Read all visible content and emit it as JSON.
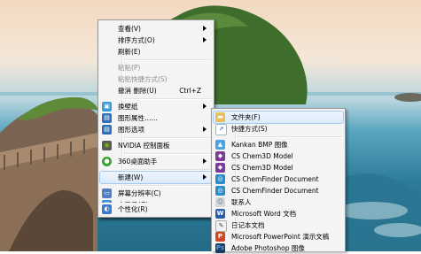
{
  "context_menu": {
    "items": [
      {
        "label": "查看(V)",
        "submenu": true,
        "disabled": false
      },
      {
        "label": "排序方式(O)",
        "submenu": true,
        "disabled": false
      },
      {
        "label": "刷新(E)",
        "disabled": false
      },
      {
        "label": "粘贴(P)",
        "disabled": true
      },
      {
        "label": "粘贴快捷方式(S)",
        "disabled": true
      },
      {
        "label": "撤消 删除(U)",
        "shortcut": "Ctrl+Z",
        "disabled": false
      },
      {
        "label": "换壁纸",
        "submenu": true,
        "disabled": false
      },
      {
        "label": "图形属性……",
        "disabled": false
      },
      {
        "label": "图形选项",
        "submenu": true,
        "disabled": false
      },
      {
        "label": "NVIDIA 控制面板",
        "disabled": false
      },
      {
        "label": "360桌面助手",
        "submenu": true,
        "disabled": false
      },
      {
        "label": "新建(W)",
        "submenu": true,
        "disabled": false
      },
      {
        "label": "屏幕分辨率(C)",
        "disabled": false
      },
      {
        "label": "小工具(G)",
        "disabled": false
      },
      {
        "label": "个性化(R)",
        "disabled": false
      }
    ]
  },
  "new_submenu": {
    "items": [
      {
        "label": "文件夹(F)"
      },
      {
        "label": "快捷方式(S)"
      },
      {
        "label": "Kankan BMP 图像"
      },
      {
        "label": "CS Chem3D Model"
      },
      {
        "label": "CS Chem3D Model"
      },
      {
        "label": "CS ChemFinder Document"
      },
      {
        "label": "CS ChemFinder Document"
      },
      {
        "label": "联系人"
      },
      {
        "label": "Microsoft Word 文档"
      },
      {
        "label": "日记本文档"
      },
      {
        "label": "Microsoft PowerPoint 演示文稿"
      },
      {
        "label": "Adobe Photoshop 图像"
      }
    ]
  },
  "colors": {
    "menu_bg": "#f4f4f4",
    "highlight": "#dceafc",
    "disabled_text": "#8d8d8d"
  }
}
